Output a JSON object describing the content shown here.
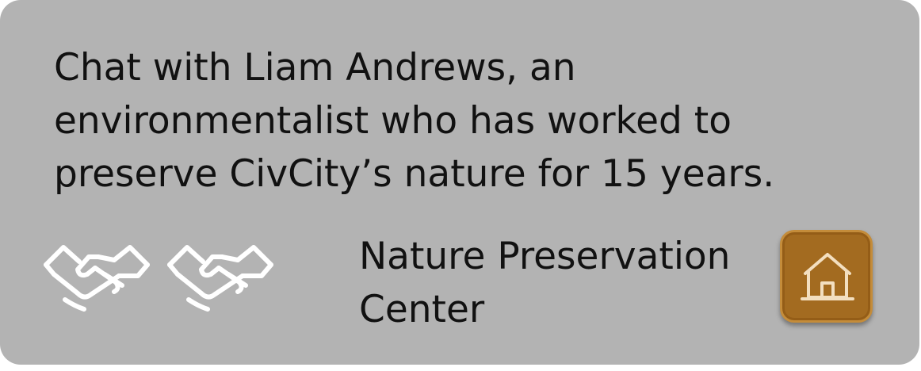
{
  "character": {
    "description": "Chat with Liam Andrews, an environmentalist who has worked to preserve CivCity’s nature for 15 years.",
    "relationship_icons": [
      "handshake-icon",
      "handshake-icon"
    ]
  },
  "location": {
    "name": "Nature Preservation Center",
    "button_icon": "home-icon"
  },
  "colors": {
    "card_background": "#b3b3b3",
    "text": "#111111",
    "icon_stroke": "#ffffff",
    "home_button": "#a36b20",
    "home_icon": "#f3dfc0"
  }
}
